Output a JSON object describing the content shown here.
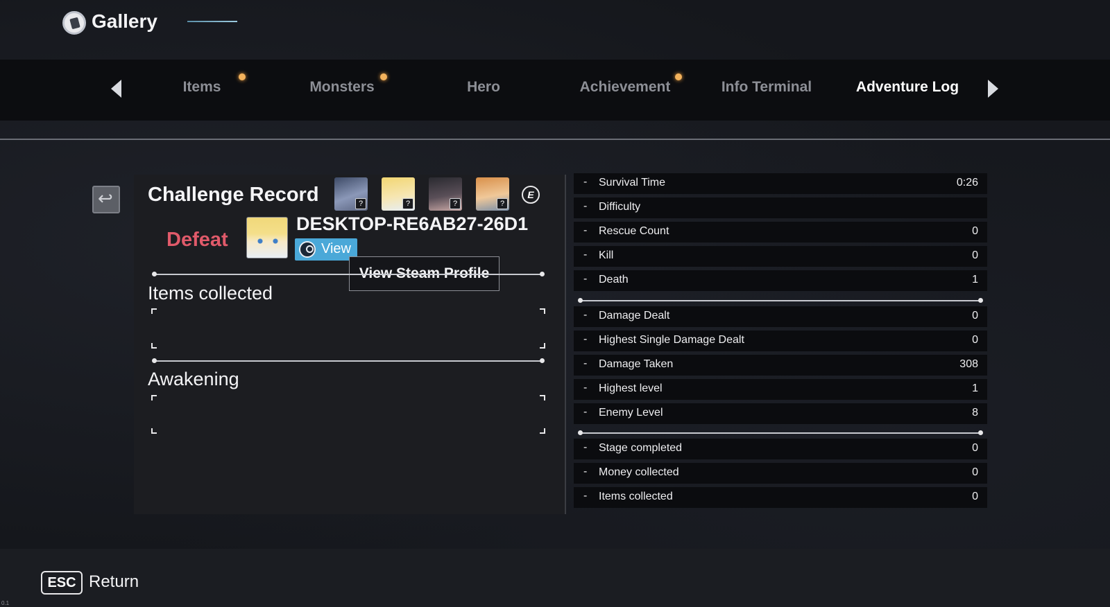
{
  "header": {
    "title": "Gallery",
    "icon": "gallery-book-icon"
  },
  "tabs": [
    {
      "label": "Items",
      "has_dot": true,
      "active": false
    },
    {
      "label": "Monsters",
      "has_dot": true,
      "active": false
    },
    {
      "label": "Hero",
      "has_dot": false,
      "active": false
    },
    {
      "label": "Achievement",
      "has_dot": true,
      "active": false
    },
    {
      "label": "Info Terminal",
      "has_dot": false,
      "active": false
    },
    {
      "label": "Adventure Log",
      "has_dot": false,
      "active": true
    }
  ],
  "record": {
    "title": "Challenge Record",
    "result": "Defeat",
    "player_name": "DESKTOP-RE6AB27-26D1",
    "view_label": "View",
    "tooltip": "View Steam Profile",
    "hero_badge": "?",
    "e_key": "E",
    "items_title": "Items collected",
    "awakening_title": "Awakening"
  },
  "stats": [
    {
      "label": "Survival Time",
      "value": "0:26"
    },
    {
      "label": "Difficulty",
      "value": ""
    },
    {
      "label": "Rescue Count",
      "value": "0"
    },
    {
      "label": "Kill",
      "value": "0"
    },
    {
      "label": "Death",
      "value": "1"
    },
    {
      "label": "Damage Dealt",
      "value": "0"
    },
    {
      "label": "Highest Single Damage Dealt",
      "value": "0"
    },
    {
      "label": "Damage Taken",
      "value": "308"
    },
    {
      "label": "Highest level",
      "value": "1"
    },
    {
      "label": "Enemy Level",
      "value": "8"
    },
    {
      "label": "Stage completed",
      "value": "0"
    },
    {
      "label": "Money collected",
      "value": "0"
    },
    {
      "label": "Items collected",
      "value": "0"
    }
  ],
  "footer": {
    "key": "ESC",
    "label": "Return",
    "version": "0.1"
  },
  "colors": {
    "accent": "#f3b25c",
    "defeat": "#e05a6a",
    "steam_button": "#4aa8d8"
  }
}
